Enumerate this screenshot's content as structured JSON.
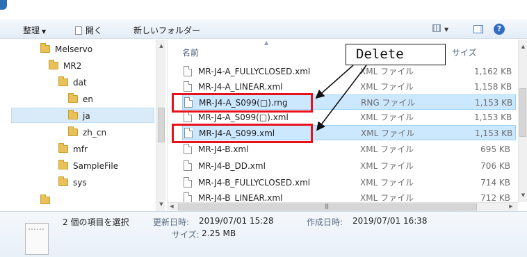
{
  "toolbar": {
    "organize_label": "整理",
    "open_label": "開く",
    "new_folder_label": "新しいフォルダー",
    "help_glyph": "?"
  },
  "nav": {
    "items": [
      {
        "label": "Melservo"
      },
      {
        "label": "MR2"
      },
      {
        "label": "dat"
      },
      {
        "label": "en"
      },
      {
        "label": "ja"
      },
      {
        "label": "zh_cn"
      },
      {
        "label": "mfr"
      },
      {
        "label": "SampleFile"
      },
      {
        "label": "sys"
      }
    ]
  },
  "columns": {
    "name": "名前",
    "size": "サイズ"
  },
  "files": [
    {
      "name": "MR-J4-A_FULLYCLOSED.xml",
      "type": "XML ファイル",
      "size": "1,162 KB"
    },
    {
      "name": "MR-J4-A_LINEAR.xml",
      "type": "XML ファイル",
      "size": "1,158 KB"
    },
    {
      "name": "MR-J4-A_S099(□).rng",
      "type": "RNG ファイル",
      "size": "1,153 KB"
    },
    {
      "name": "MR-J4-A_S099(□).xml",
      "type": "XML ファイル",
      "size": "1,153 KB"
    },
    {
      "name": "MR-J4-A_S099.xml",
      "type": "XML ファイル",
      "size": "1,153 KB"
    },
    {
      "name": "MR-J4-B.xml",
      "type": "XML ファイル",
      "size": "695 KB"
    },
    {
      "name": "MR-J4-B_DD.xml",
      "type": "XML ファイル",
      "size": "706 KB"
    },
    {
      "name": "MR-J4-B_FULLYCLOSED.xml",
      "type": "XML ファイル",
      "size": "714 KB"
    },
    {
      "name": "MR-J4-B_LINEAR.xml",
      "type": "XML ファイル",
      "size": "712 KB"
    }
  ],
  "annotation": {
    "label": "Delete",
    "color": "#e8101a"
  },
  "details": {
    "selection_text": "2 個の項目を選択",
    "modified_label": "更新日時:",
    "modified_value": "2019/07/01 15:28",
    "created_label": "作成日時:",
    "created_value": "2019/07/01 16:38",
    "size_label": "サイズ:",
    "size_value": "2.25 MB"
  }
}
